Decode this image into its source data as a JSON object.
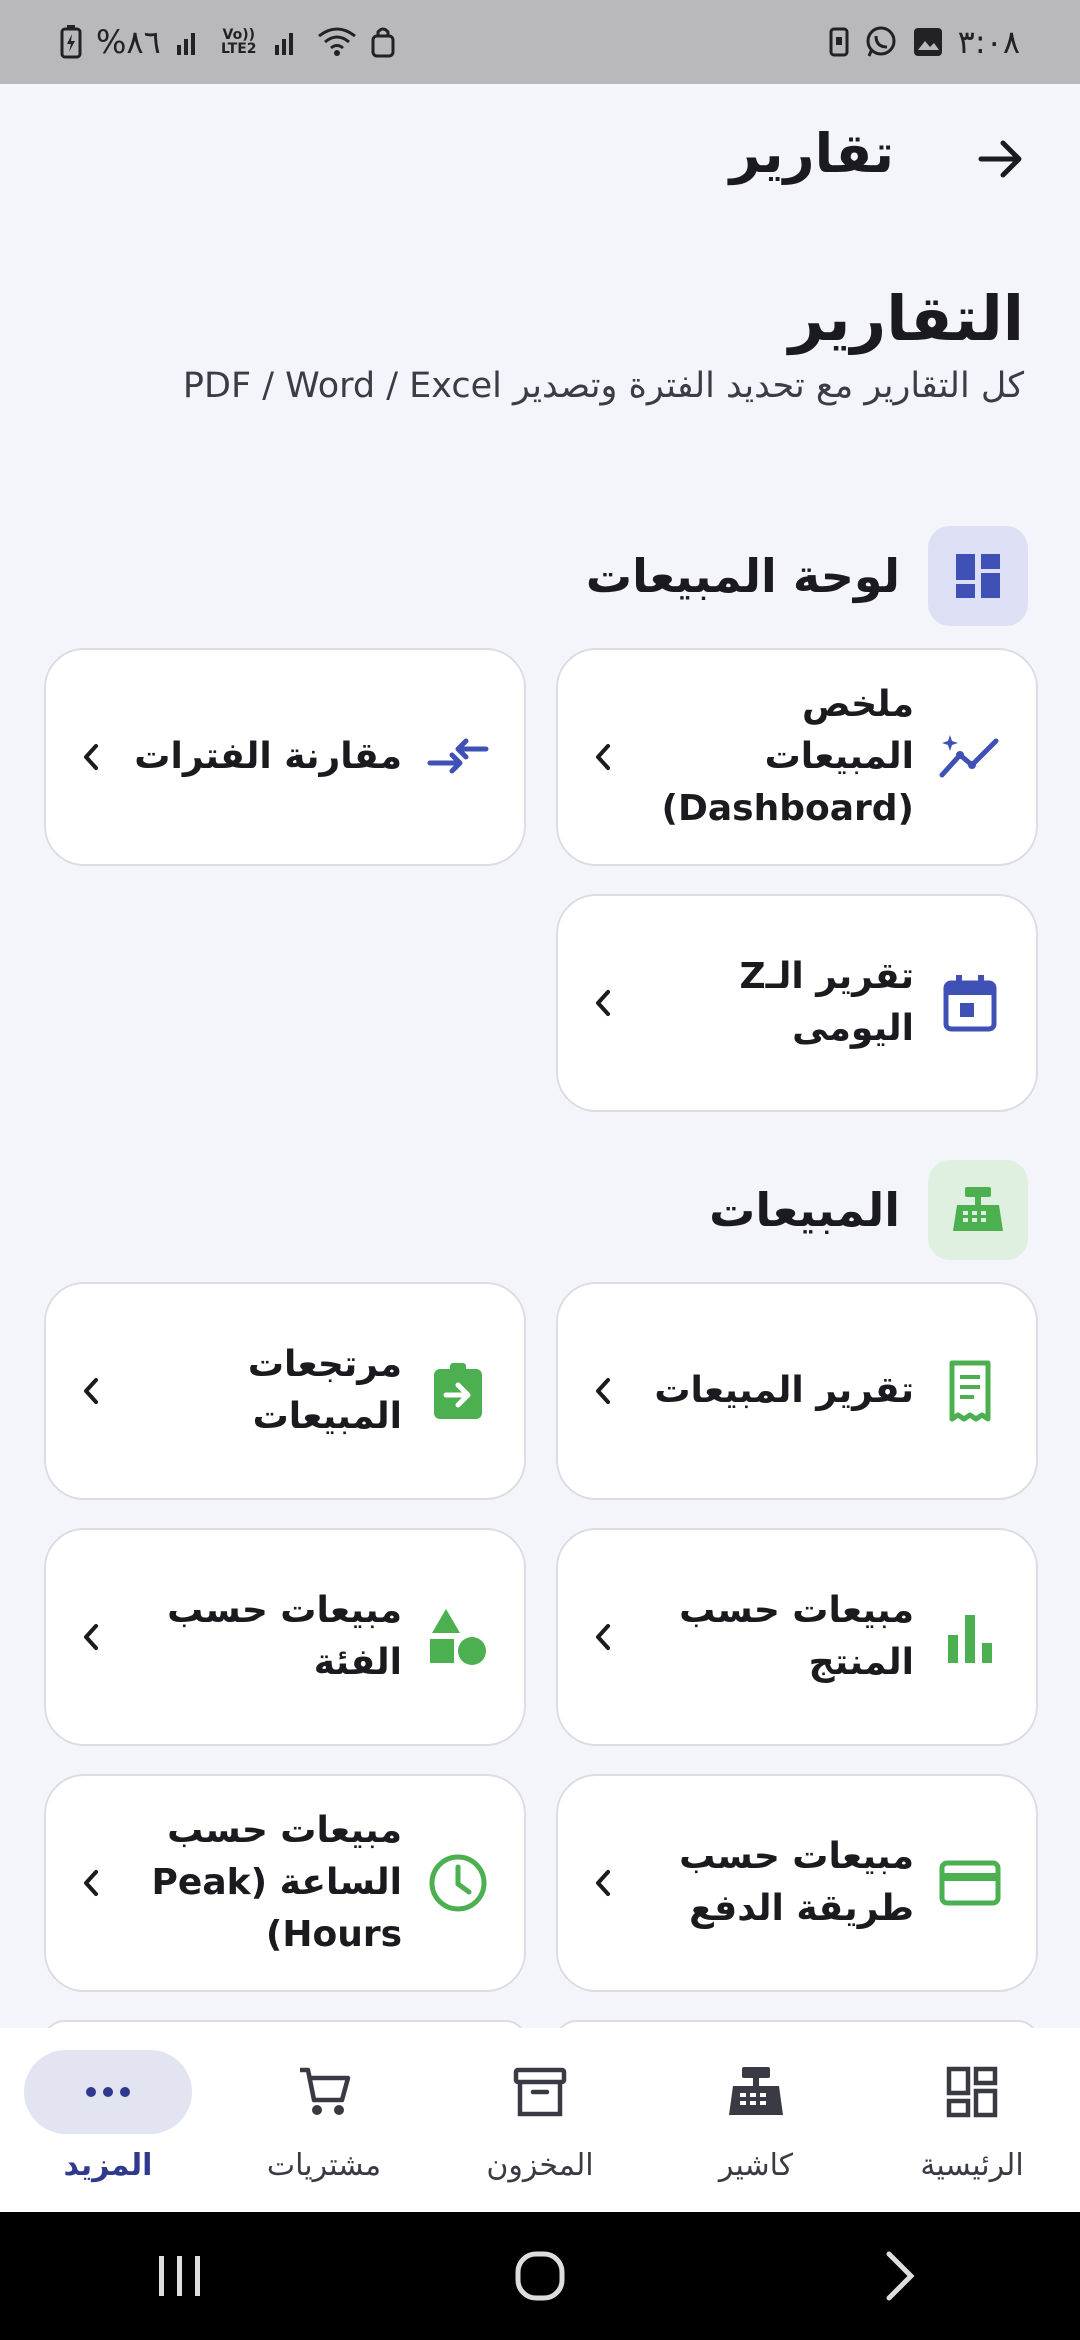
{
  "status_bar": {
    "time": "٣:٠٨",
    "battery": "%٨٦",
    "network_label": "Vo)) LTE2"
  },
  "app_bar": {
    "title": "تقارير"
  },
  "header": {
    "title": "التقارير",
    "subtitle": "كل التقارير مع تحديد الفترة وتصدير PDF / Word / Excel"
  },
  "sections": [
    {
      "title": "لوحة المبيعات",
      "icon": "dashboard-icon",
      "accent": "#3f51b5",
      "icon_bg": "#dde0f5",
      "cards": [
        {
          "label": "ملخص المبيعات (Dashboard)",
          "icon": "trending-icon"
        },
        {
          "label": "مقارنة الفترات",
          "icon": "compare-arrows-icon"
        },
        {
          "label": "تقرير الـZ اليومى",
          "icon": "calendar-icon"
        }
      ]
    },
    {
      "title": "المبيعات",
      "icon": "cash-register-icon",
      "accent": "#4caf50",
      "icon_bg": "#dff0e0",
      "cards": [
        {
          "label": "تقرير المبيعات",
          "icon": "receipt-icon"
        },
        {
          "label": "مرتجعات المبيعات",
          "icon": "return-clipboard-icon"
        },
        {
          "label": "مبيعات حسب المنتج",
          "icon": "bar-chart-icon"
        },
        {
          "label": "مبيعات حسب الفئة",
          "icon": "category-shapes-icon"
        },
        {
          "label": "مبيعات حسب طريقة الدفع",
          "icon": "credit-card-icon"
        },
        {
          "label": "مبيعات حسب الساعة (Peak Hours)",
          "icon": "clock-icon"
        }
      ]
    }
  ],
  "bottom_nav": [
    {
      "label": "الرئيسية",
      "icon": "grid-home-icon",
      "active": false
    },
    {
      "label": "كاشير",
      "icon": "cash-register-icon",
      "active": false
    },
    {
      "label": "المخزون",
      "icon": "archive-box-icon",
      "active": false
    },
    {
      "label": "مشتريات",
      "icon": "cart-icon",
      "active": false
    },
    {
      "label": "المزيد",
      "icon": "more-dots-icon",
      "active": true
    }
  ],
  "colors": {
    "background": "#f4f5fa",
    "primary": "#2f3a8f",
    "indigo_accent": "#3f51b5",
    "green_accent": "#4caf50"
  }
}
